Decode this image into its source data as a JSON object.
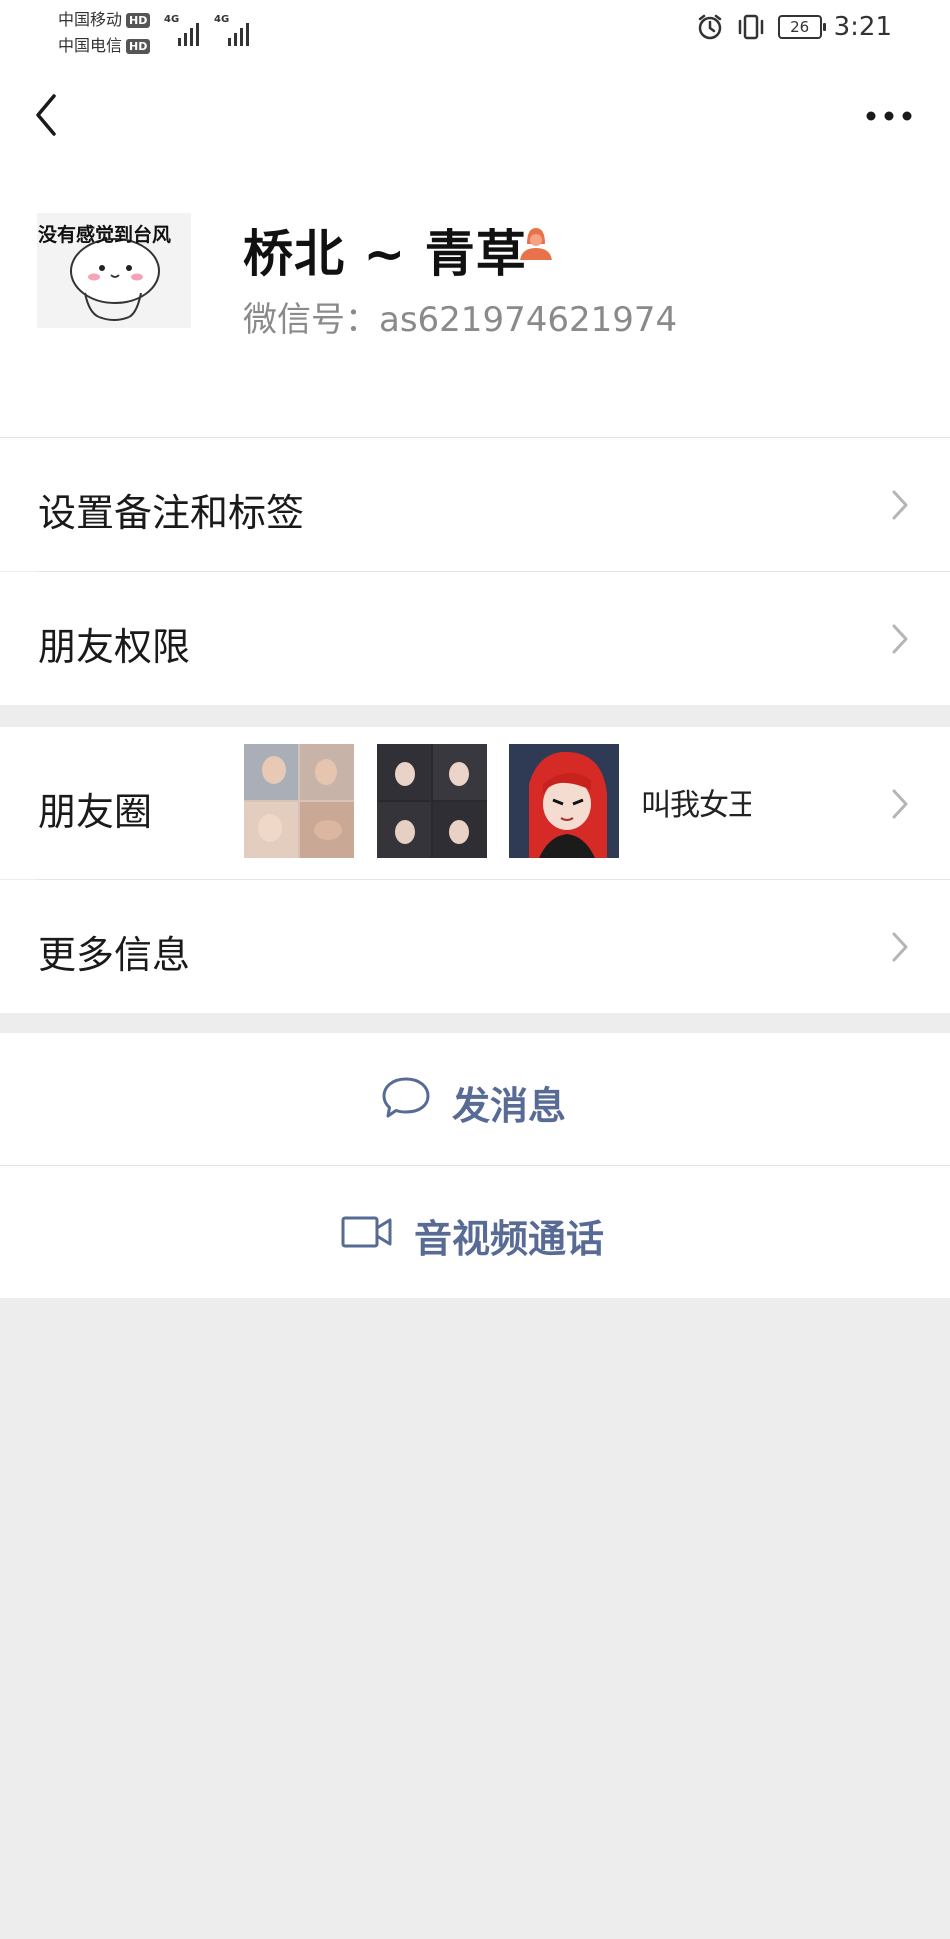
{
  "status_bar": {
    "carrier1": "中国移动",
    "carrier2": "中国电信",
    "hd": "HD",
    "network1": "4G",
    "network2": "4G",
    "battery": "26",
    "time": "3:21"
  },
  "profile": {
    "avatar_caption": "没有感觉到台风",
    "nickname": "桥北 ~ 青草",
    "wechat_id": "微信号：as621974621974",
    "gender_icon_color": "#e8734a"
  },
  "menu": {
    "remarks_tags": "设置备注和标签",
    "friend_permissions": "朋友权限",
    "moments": "朋友圈",
    "moments_thumb4_text": "叫我女王",
    "more_info": "更多信息"
  },
  "actions": {
    "send_message": "发消息",
    "av_call": "音视频通话",
    "link_color": "#576b95"
  }
}
